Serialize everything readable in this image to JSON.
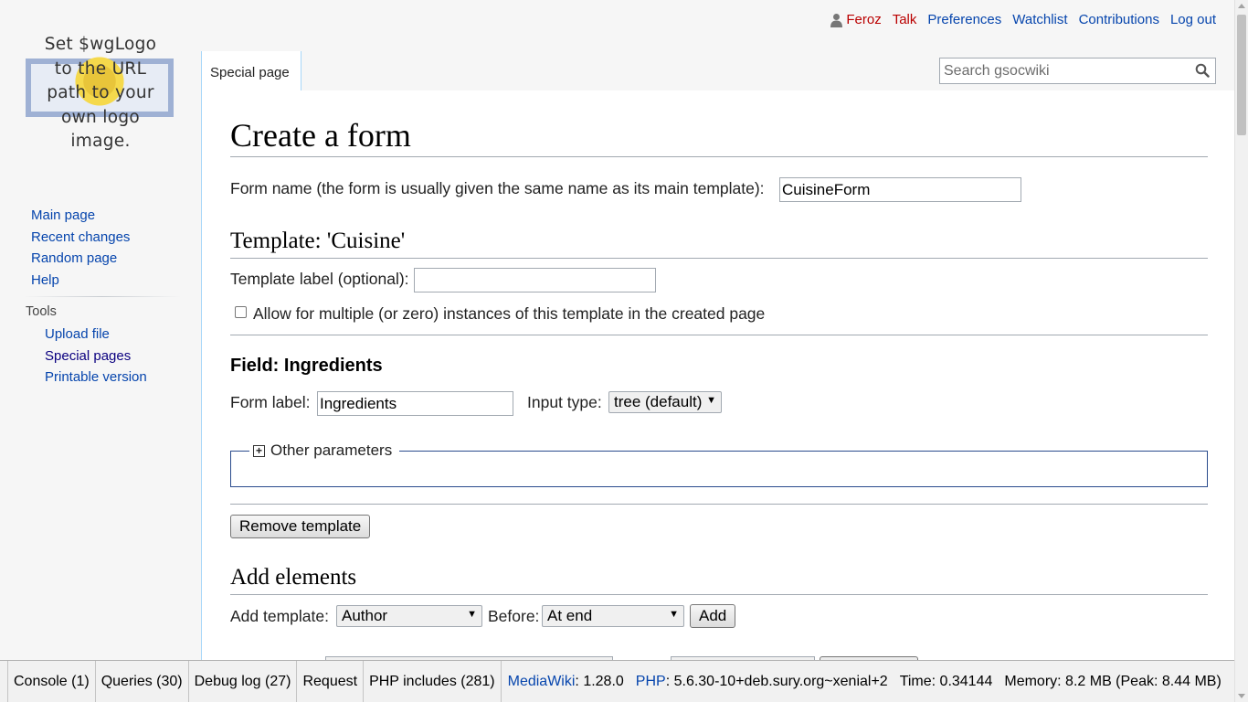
{
  "personal_tools": {
    "username": "Feroz",
    "talk": "Talk",
    "preferences": "Preferences",
    "watchlist": "Watchlist",
    "contributions": "Contributions",
    "logout": "Log out"
  },
  "logo": {
    "lines": [
      "Set $wgLogo",
      "to the URL",
      "path to your",
      "own logo",
      "image."
    ]
  },
  "sidebar": {
    "navigation": [
      "Main page",
      "Recent changes",
      "Random page",
      "Help"
    ],
    "tools_heading": "Tools",
    "tools": [
      "Upload file",
      "Special pages",
      "Printable version"
    ]
  },
  "tabs": {
    "special_page": "Special page"
  },
  "search": {
    "placeholder": "Search gsocwiki",
    "icon": "magnifier-icon"
  },
  "main": {
    "title": "Create a form",
    "form_name_label": "Form name (the form is usually given the same name as its main template):",
    "form_name_value": "CuisineForm",
    "template_heading": "Template: 'Cuisine'",
    "template_label_label": "Template label (optional):",
    "template_label_value": "",
    "multiple_instances_label": "Allow for multiple (or zero) instances of this template in the created page",
    "multiple_instances_checked": false,
    "field_heading": "Field: Ingredients",
    "form_label_label": "Form label:",
    "form_label_value": "Ingredients",
    "input_type_label": "Input type:",
    "input_type_value": "tree (default)",
    "other_parameters": "Other parameters",
    "remove_template": "Remove template",
    "add_elements_heading": "Add elements",
    "add_template_label": "Add template:",
    "add_template_value": "Author",
    "before_label": "Before:",
    "before_value": "At end",
    "add_button": "Add"
  },
  "debug_toolbar": {
    "console": "Console (1)",
    "queries": "Queries (30)",
    "debug_log": "Debug log (27)",
    "request": "Request",
    "php_includes": "PHP includes (281)",
    "mediawiki_link": "MediaWiki",
    "mediawiki_version": ": 1.28.0",
    "php_link": "PHP",
    "php_version": ": 5.6.30-10+deb.sury.org~xenial+2",
    "time": "Time: 0.34144",
    "memory": "Memory: 8.2 MB (Peak: 8.44 MB)"
  }
}
